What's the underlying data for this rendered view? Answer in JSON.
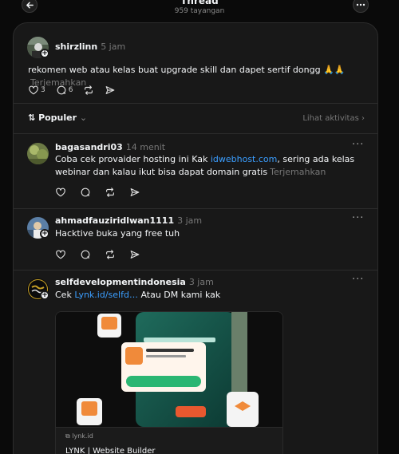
{
  "header": {
    "title": "Thread",
    "views": "959 tayangan"
  },
  "op": {
    "username": "shirzlinn",
    "time": "5 jam",
    "text": "rekomen web atau kelas buat upgrade skill dan dapet sertif dongg 🙏🙏",
    "translate": "Terjemahkan",
    "likes": "3",
    "comments": "6"
  },
  "sort": {
    "label": "Populer",
    "activity": "Lihat aktivitas"
  },
  "replies": [
    {
      "username": "bagasandri03",
      "time": "14 menit",
      "text_before": "Coba cek provaider hosting ini Kak ",
      "link": "idwebhost.com",
      "text_after": ", sering ada kelas webinar dan kalau ikut bisa dapat domain gratis",
      "translate": "Terjemahkan"
    },
    {
      "username": "ahmadfauziridlwan1111",
      "time": "3 jam",
      "text": "Hacktive buka yang free tuh"
    },
    {
      "username": "selfdevelopmentindonesia",
      "time": "3 jam",
      "text_before": "Cek ",
      "link": "Lynk.id/selfd…",
      "text_after": " Atau DM kami kak",
      "preview_domain": "lynk.id",
      "preview_title": "LYNK | Website Builder"
    }
  ],
  "colors": {
    "background": "#0a0a0a",
    "card": "#181818",
    "link": "#3b9eff"
  }
}
